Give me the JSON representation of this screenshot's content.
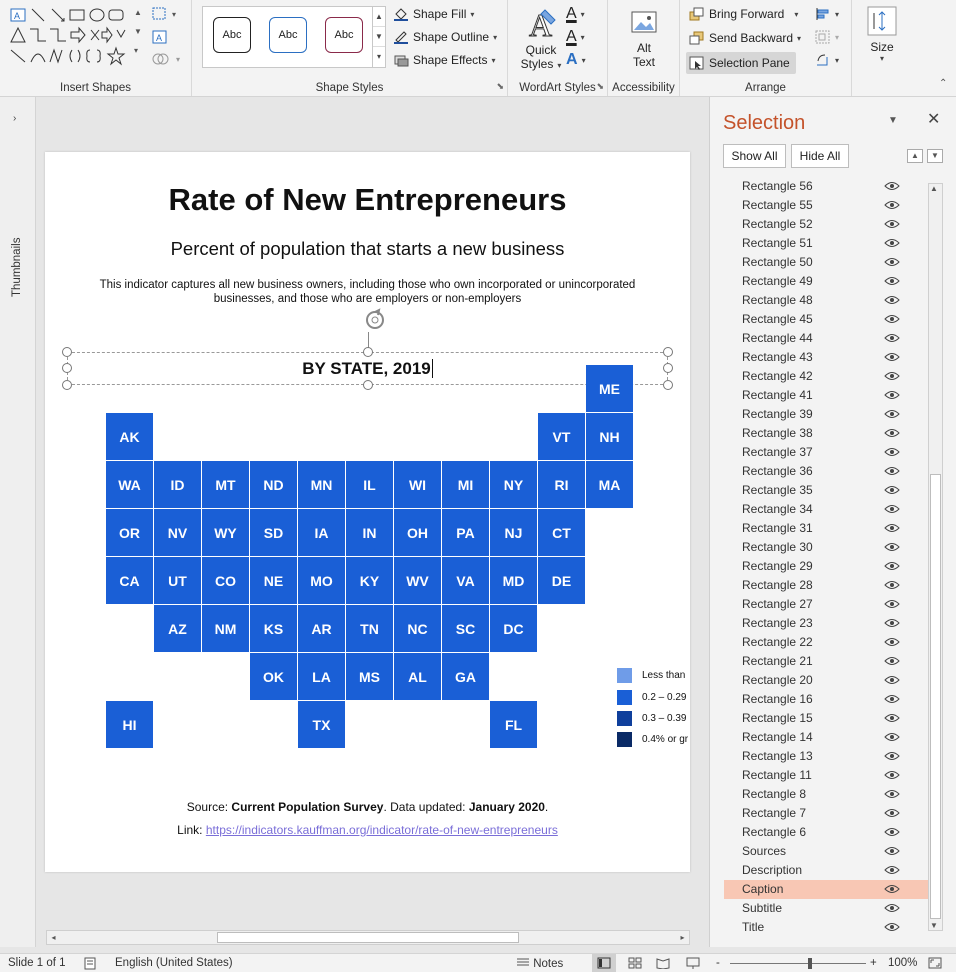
{
  "ribbon": {
    "groups": {
      "insert_shapes": "Insert Shapes",
      "shape_styles": "Shape Styles",
      "wordart_styles": "WordArt Styles",
      "accessibility": "Accessibility",
      "arrange": "Arrange"
    },
    "style_thumb_label": "Abc",
    "shape_fill": "Shape Fill",
    "shape_outline": "Shape Outline",
    "shape_effects": "Shape Effects",
    "quick_styles_1": "Quick",
    "quick_styles_2": "Styles",
    "alt_text_1": "Alt",
    "alt_text_2": "Text",
    "bring_forward": "Bring Forward",
    "send_backward": "Send Backward",
    "selection_pane": "Selection Pane",
    "size": "Size",
    "text_fill_glyph": "A",
    "accent_color": "#c00000"
  },
  "thumbnails_label": "Thumbnails",
  "slide": {
    "title": "Rate of New Entrepreneurs",
    "subtitle": "Percent of population that starts a new business",
    "description": "This indicator captures all new business owners, including those who own incorporated or unincorporated businesses, and those who are employers or non-employers",
    "caption": "BY STATE, 2019",
    "tile_color": "#1a5fd6",
    "tiles": [
      "ME",
      "AK",
      "VT",
      "NH",
      "WA",
      "ID",
      "MT",
      "ND",
      "MN",
      "IL",
      "WI",
      "MI",
      "NY",
      "RI",
      "MA",
      "OR",
      "NV",
      "WY",
      "SD",
      "IA",
      "IN",
      "OH",
      "PA",
      "NJ",
      "CT",
      "CA",
      "UT",
      "CO",
      "NE",
      "MO",
      "KY",
      "WV",
      "VA",
      "MD",
      "DE",
      "AZ",
      "NM",
      "KS",
      "AR",
      "TN",
      "NC",
      "SC",
      "DC",
      "OK",
      "LA",
      "MS",
      "AL",
      "GA",
      "HI",
      "TX",
      "FL"
    ],
    "legend": [
      {
        "label": "Less than",
        "color": "#6f9ce8"
      },
      {
        "label": "0.2 – 0.29",
        "color": "#1a5fd6"
      },
      {
        "label": "0.3 – 0.39",
        "color": "#0f3f9c"
      },
      {
        "label": "0.4% or gr",
        "color": "#0a2a66"
      }
    ],
    "source_prefix": "Source: ",
    "source_name": "Current Population Survey",
    "source_mid": ". Data updated: ",
    "source_date": "January 2020",
    "source_end": ".",
    "link_prefix": "Link: ",
    "link_url": "https://indicators.kauffman.org/indicator/rate-of-new-entrepreneurs"
  },
  "selection_pane": {
    "title": "Selection",
    "show_all": "Show All",
    "hide_all": "Hide All",
    "items": [
      "Rectangle 56",
      "Rectangle 55",
      "Rectangle 52",
      "Rectangle 51",
      "Rectangle 50",
      "Rectangle 49",
      "Rectangle 48",
      "Rectangle 45",
      "Rectangle 44",
      "Rectangle 43",
      "Rectangle 42",
      "Rectangle 41",
      "Rectangle 39",
      "Rectangle 38",
      "Rectangle 37",
      "Rectangle 36",
      "Rectangle 35",
      "Rectangle 34",
      "Rectangle 31",
      "Rectangle 30",
      "Rectangle 29",
      "Rectangle 28",
      "Rectangle 27",
      "Rectangle 23",
      "Rectangle 22",
      "Rectangle 21",
      "Rectangle 20",
      "Rectangle 16",
      "Rectangle 15",
      "Rectangle 14",
      "Rectangle 13",
      "Rectangle 11",
      "Rectangle 8",
      "Rectangle 7",
      "Rectangle 6",
      "Sources",
      "Description",
      "Caption",
      "Subtitle",
      "Title"
    ],
    "selected_item": "Caption"
  },
  "status": {
    "slide": "Slide 1 of 1",
    "language": "English (United States)",
    "notes": "Notes",
    "zoom": "100%",
    "zoom_minus": "-",
    "zoom_plus": "+"
  }
}
